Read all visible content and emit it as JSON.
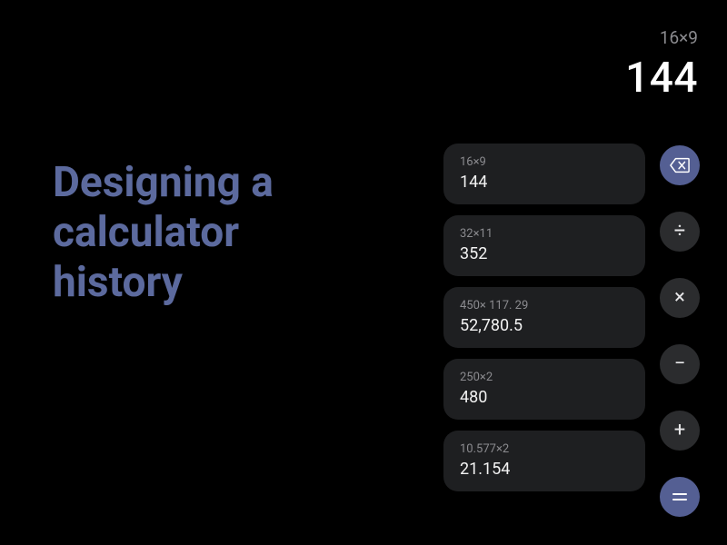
{
  "headline": "Designing a calculator history",
  "display": {
    "expression": "16×9",
    "result": "144"
  },
  "history": [
    {
      "expression": "16×9",
      "result": "144"
    },
    {
      "expression": "32×11",
      "result": "352"
    },
    {
      "expression": "450× 117. 29",
      "result": "52,780.5"
    },
    {
      "expression": "250×2",
      "result": "480"
    },
    {
      "expression": "10.577×2",
      "result": "21.154"
    }
  ],
  "ops": {
    "backspace_icon": "backspace",
    "divide_label": "÷",
    "multiply_label": "×",
    "subtract_label": "−",
    "add_label": "+",
    "equals_label": "="
  },
  "colors": {
    "accent": "#545f93",
    "background": "#000000",
    "card": "#1e1f21",
    "op_button": "#2b2c2e",
    "headline": "#5c6a9e"
  }
}
